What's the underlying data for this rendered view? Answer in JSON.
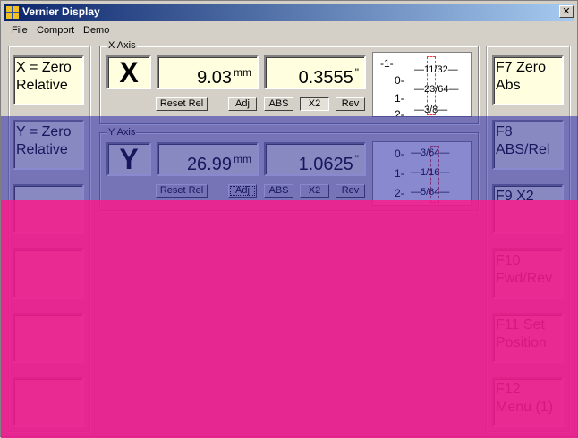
{
  "window": {
    "title": "Vernier Display",
    "close_glyph": "✕"
  },
  "menu": [
    "File",
    "Comport",
    "Demo"
  ],
  "left_keys": [
    "X = Zero\nRelative",
    "Y = Zero\nRelative",
    "",
    "",
    "",
    ""
  ],
  "right_keys": [
    "F7 Zero\nAbs",
    "F8\nABS/Rel",
    "F9 X2",
    "F10\nFwd/Rev",
    "F11 Set\nPosition",
    "F12\nMenu (1)"
  ],
  "x_axis": {
    "group_label": "X Axis",
    "letter": "X",
    "mm_value": "9.03",
    "mm_unit": "mm",
    "inch_value": "0.3555",
    "inch_unit": "\"",
    "buttons": {
      "reset": "Reset Rel",
      "adj": "Adj",
      "abs": "ABS",
      "x2": "X2",
      "rev": "Rev"
    },
    "scale": {
      "whole": [
        "-1-",
        "0-",
        "1-",
        "2-"
      ],
      "fractions": [
        "11/32",
        "23/64",
        "3/8"
      ]
    }
  },
  "y_axis": {
    "group_label": "Y Axis",
    "letter": "Y",
    "mm_value": "26.99",
    "mm_unit": "mm",
    "inch_value": "1.0625",
    "inch_unit": "\"",
    "buttons": {
      "reset": "Reset Rel",
      "adj": "Adj",
      "abs": "ABS",
      "x2": "X2",
      "rev": "Rev"
    },
    "scale": {
      "whole": [
        "0-",
        "1-",
        "2-"
      ],
      "fractions": [
        "3/64",
        "1/16",
        "5/64"
      ]
    }
  },
  "overlay_colors": {
    "blue": "#2828aa",
    "pink": "#e8188c"
  }
}
